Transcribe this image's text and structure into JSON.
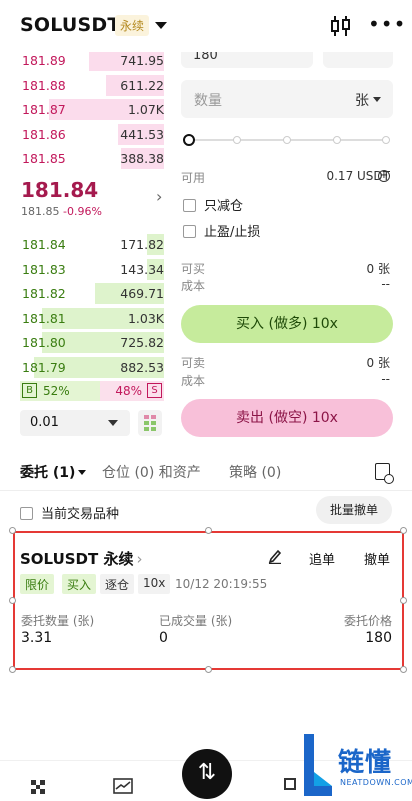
{
  "header": {
    "symbol": "SOLUSDT",
    "contract_tag": "永续"
  },
  "order_book": {
    "asks": [
      {
        "price": "181.89",
        "qty": "741.95",
        "depth": 0.52
      },
      {
        "price": "181.88",
        "qty": "611.22",
        "depth": 0.4
      },
      {
        "price": "181.87",
        "qty": "1.07K",
        "depth": 0.8
      },
      {
        "price": "181.86",
        "qty": "441.53",
        "depth": 0.32
      },
      {
        "price": "181.85",
        "qty": "388.38",
        "depth": 0.3
      }
    ],
    "last_price": "181.84",
    "mark_price": "181.85",
    "change": "-0.96%",
    "bids": [
      {
        "price": "181.84",
        "qty": "171.82",
        "depth": 0.12
      },
      {
        "price": "181.83",
        "qty": "143.34",
        "depth": 0.12
      },
      {
        "price": "181.82",
        "qty": "469.71",
        "depth": 0.48
      },
      {
        "price": "181.81",
        "qty": "1.03K",
        "depth": 0.85
      },
      {
        "price": "181.80",
        "qty": "725.82",
        "depth": 0.85
      },
      {
        "price": "181.79",
        "qty": "882.53",
        "depth": 0.9
      }
    ],
    "buy_label": "B",
    "buy_ratio": "52%",
    "sell_ratio": "48%",
    "sell_label": "S",
    "step": "0.01"
  },
  "form": {
    "price_value": "180",
    "quantity_placeholder": "数量",
    "quantity_unit": "张",
    "available_label": "可用",
    "available_value": "0.17 USDT",
    "reduce_only": "只减仓",
    "tp_sl": "止盈/止损",
    "can_buy_label": "可买",
    "can_buy_value": "0 张",
    "cost_label": "成本",
    "cost_value": "--",
    "buy_button": "买入 (做多) 10x",
    "can_sell_label": "可卖",
    "can_sell_value": "0 张",
    "sell_cost_label": "成本",
    "sell_cost_value": "--",
    "sell_button": "卖出 (做空) 10x"
  },
  "tabs": {
    "orders": "委托 (1)",
    "positions": "仓位 (0) 和资产",
    "strategies": "策略 (0)"
  },
  "filter": {
    "current_only": "当前交易品种",
    "batch_cancel": "批量撤单"
  },
  "order": {
    "symbol": "SOLUSDT 永续",
    "chase": "追单",
    "cancel": "撤单",
    "badges": [
      "限价",
      "买入",
      "逐仓",
      "10x"
    ],
    "time": "10/12 20:19:55",
    "amount_label": "委托数量 (张)",
    "amount_value": "3.31",
    "filled_label": "已成交量 (张)",
    "filled_value": "0",
    "price_label": "委托价格",
    "price_value": "180"
  },
  "nav": {
    "fab_icon": "⇅"
  },
  "watermark": {
    "title": "链懂",
    "subtitle": "NEATDOWN.COM"
  }
}
